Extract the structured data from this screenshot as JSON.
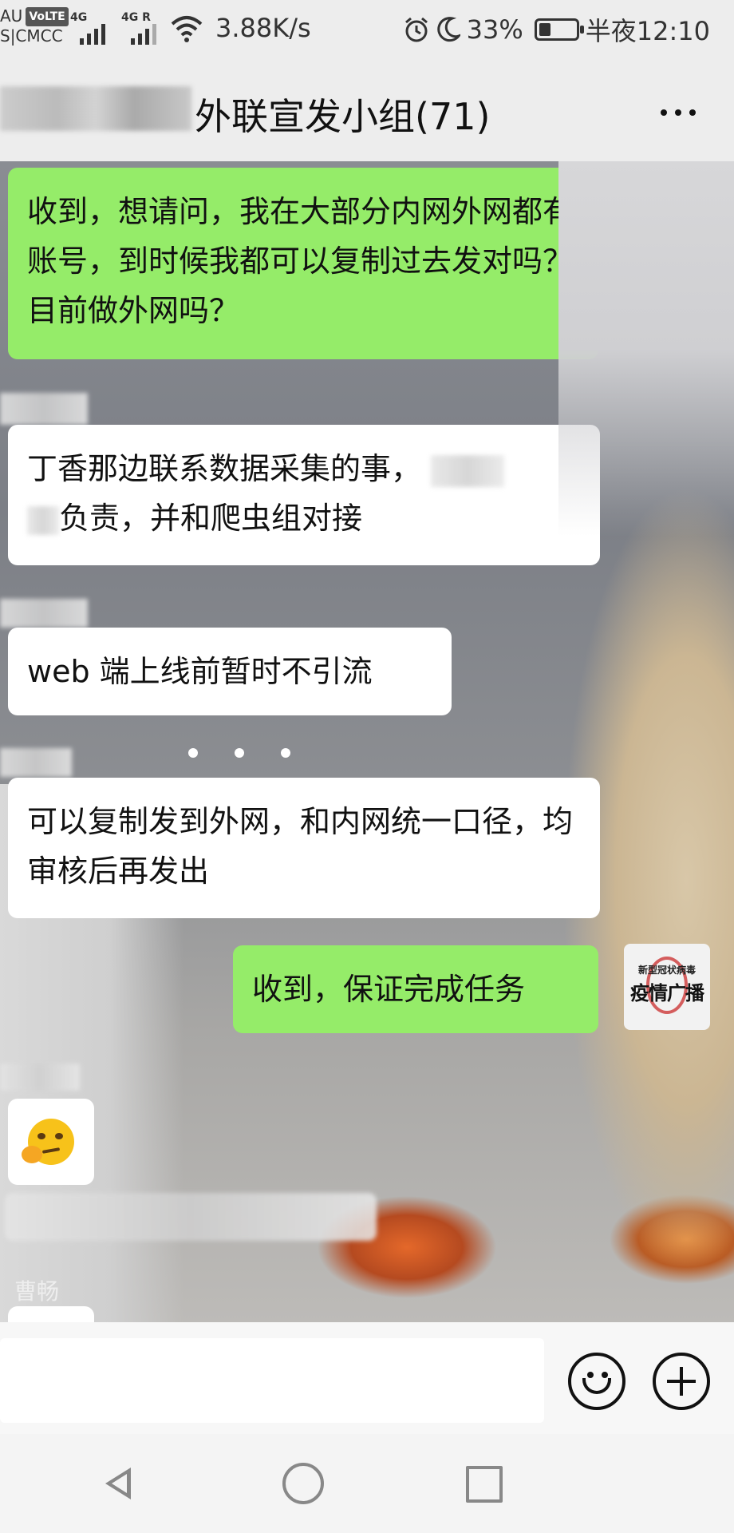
{
  "status_bar": {
    "carrier_top": "AU",
    "volte": "VoLTE",
    "carrier_bottom": "S|CMCC",
    "signal1_label": "4G",
    "signal2_label": "4G R",
    "net_speed": "3.88K/s",
    "battery": "33%",
    "battery_level": 0.33,
    "time": "半夜12:10"
  },
  "header": {
    "title": "外联宣发小组(71)"
  },
  "avatar": {
    "top": "新型冠状病毒",
    "main": "疫情广播"
  },
  "messages": {
    "m1": "收到，想请问，我在大部分内网外网都有账号，到时候我都可以复制过去发对吗？目前做外网吗？",
    "m2": "丁香那边联系数据采集的事，",
    "m2b": "负责，并和爬虫组对接",
    "m3": "web 端上线前暂时不引流",
    "m4": "可以复制发到外网，和内网统一口径，均审核后再发出",
    "m5": "收到，保证完成任务"
  },
  "bottom_sender": "曹畅"
}
